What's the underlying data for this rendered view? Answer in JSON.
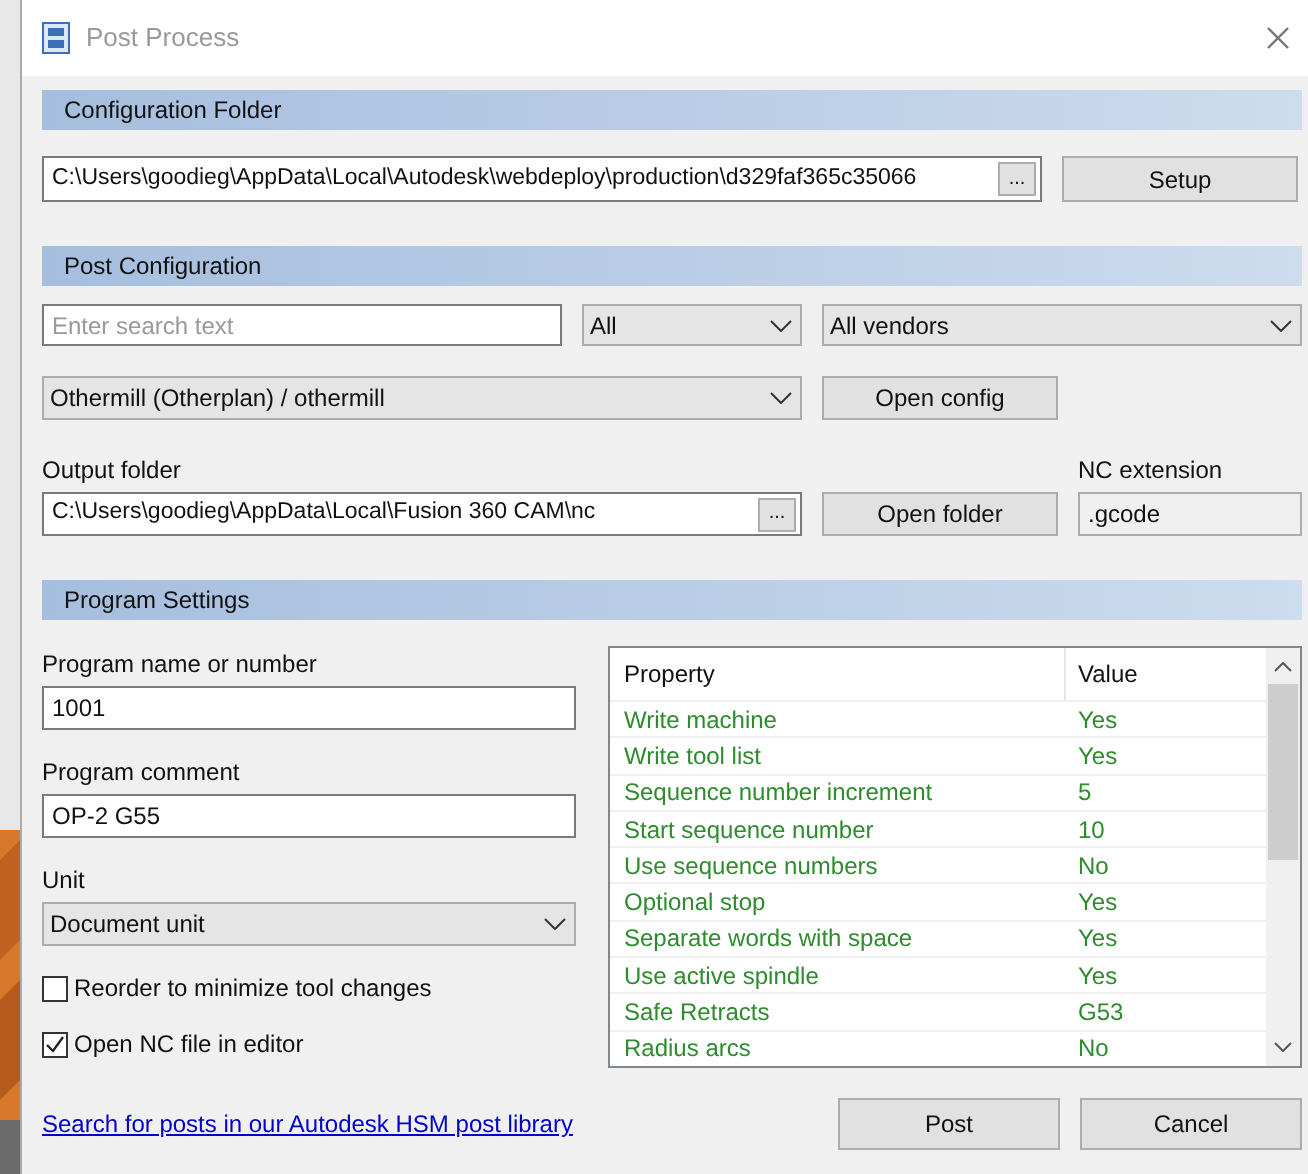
{
  "window": {
    "title": "Post Process"
  },
  "configuration_folder": {
    "header": "Configuration Folder",
    "path": "C:\\Users\\goodieg\\AppData\\Local\\Autodesk\\webdeploy\\production\\d329faf365c35066",
    "browse": "...",
    "setup_button": "Setup"
  },
  "post_configuration": {
    "header": "Post Configuration",
    "search": {
      "placeholder": "Enter search text"
    },
    "filter": "All",
    "vendor": "All vendors",
    "post": "Othermill (Otherplan) / othermill",
    "open_config_button": "Open config",
    "output_folder_label": "Output folder",
    "output_folder": "C:\\Users\\goodieg\\AppData\\Local\\Fusion 360 CAM\\nc",
    "browse": "...",
    "open_folder_button": "Open folder",
    "nc_extension_label": "NC extension",
    "nc_extension": ".gcode"
  },
  "program_settings": {
    "header": "Program Settings",
    "program_name_label": "Program name or number",
    "program_name": "1001",
    "program_comment_label": "Program comment",
    "program_comment": "OP-2 G55",
    "unit_label": "Unit",
    "unit": "Document unit",
    "checkboxes": [
      {
        "label": "Reorder to minimize tool changes",
        "checked": false
      },
      {
        "label": "Open NC file in editor",
        "checked": true
      }
    ],
    "table": {
      "columns": [
        "Property",
        "Value"
      ],
      "rows": [
        [
          "Write machine",
          "Yes"
        ],
        [
          "Write tool list",
          "Yes"
        ],
        [
          "Sequence number increment",
          "5"
        ],
        [
          "Start sequence number",
          "10"
        ],
        [
          "Use sequence numbers",
          "No"
        ],
        [
          "Optional stop",
          "Yes"
        ],
        [
          "Separate words with space",
          "Yes"
        ],
        [
          "Use active spindle",
          "Yes"
        ],
        [
          "Safe Retracts",
          "G53"
        ],
        [
          "Radius arcs",
          "No"
        ]
      ]
    }
  },
  "link": "Search for posts in our Autodesk HSM post library",
  "buttons": [
    "Post",
    "Cancel"
  ]
}
